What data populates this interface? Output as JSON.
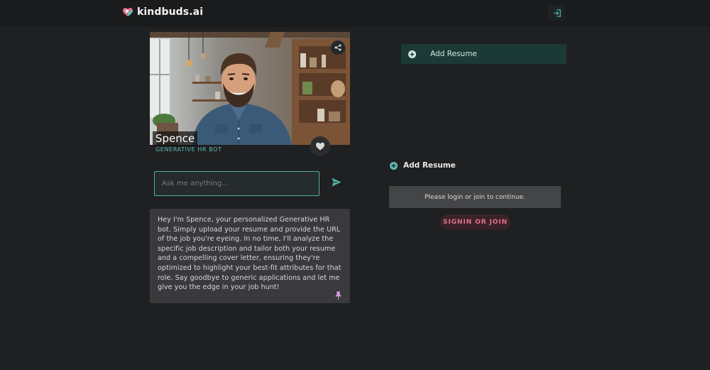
{
  "header": {
    "brand_name": "kindbuds.ai",
    "logo_icon": "heart-logo-icon",
    "login_icon": "login-icon"
  },
  "bot": {
    "name": "Spence",
    "role": "GENERATIVE HR BOT",
    "share_icon": "share-icon",
    "favorite_icon": "heart-icon"
  },
  "chat": {
    "placeholder": "Ask me anything...",
    "value": "",
    "send_icon": "send-icon"
  },
  "intro": {
    "text": "Hey I'm Spence, your personalized Generative HR bot. Simply upload your resume and provide the URL of the job you're eyeing. In no time, I'll analyze the specific job description and tailor both your resume and a compelling cover letter, ensuring they're optimized to highlight your best-fit attributes for that role. Say goodbye to generic applications and let me give you the edge in your job hunt!",
    "pin_icon": "pin-icon"
  },
  "actions": {
    "add_resume_top_label": "Add Resume",
    "add_resume_label": "Add Resume",
    "plus_icon": "plus-circle-icon",
    "login_notice": "Please login or join to continue.",
    "signin_label": "SIGNIN OR JOIN"
  },
  "colors": {
    "background": "#1f2021",
    "accent_teal": "#5ebfb2",
    "signin_pink": "#e0708a"
  }
}
